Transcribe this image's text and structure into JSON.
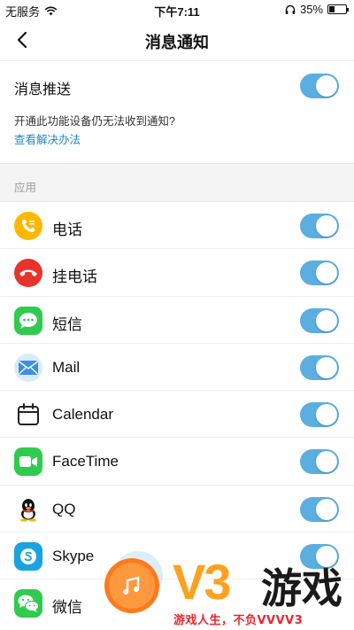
{
  "status_bar": {
    "carrier": "无服务",
    "time": "下午7:11",
    "battery": "35%",
    "battery_level": 0.35
  },
  "nav": {
    "title": "消息通知"
  },
  "push": {
    "label": "消息推送",
    "enabled": true,
    "hint": "开通此功能设备仍无法收到通知?",
    "link": "查看解决办法"
  },
  "section": {
    "label": "应用"
  },
  "apps": [
    {
      "name": "电话",
      "icon": "phone-call-icon",
      "enabled": true
    },
    {
      "name": "挂电话",
      "icon": "hang-up-icon",
      "enabled": true
    },
    {
      "name": "短信",
      "icon": "message-icon",
      "enabled": true
    },
    {
      "name": "Mail",
      "icon": "mail-icon",
      "enabled": true
    },
    {
      "name": "Calendar",
      "icon": "calendar-icon",
      "enabled": true
    },
    {
      "name": "FaceTime",
      "icon": "facetime-icon",
      "enabled": true
    },
    {
      "name": "QQ",
      "icon": "qq-icon",
      "enabled": true
    },
    {
      "name": "Skype",
      "icon": "skype-icon",
      "enabled": true
    },
    {
      "name": "微信",
      "icon": "wechat-icon",
      "enabled": true
    }
  ],
  "watermark": {
    "brand": "V3",
    "name": "游戏",
    "slogan": "游戏人生，不负VVVV3"
  },
  "colors": {
    "toggle_on": "#5aaee0",
    "link": "#1e88c8",
    "accent": "#ffa11f"
  }
}
